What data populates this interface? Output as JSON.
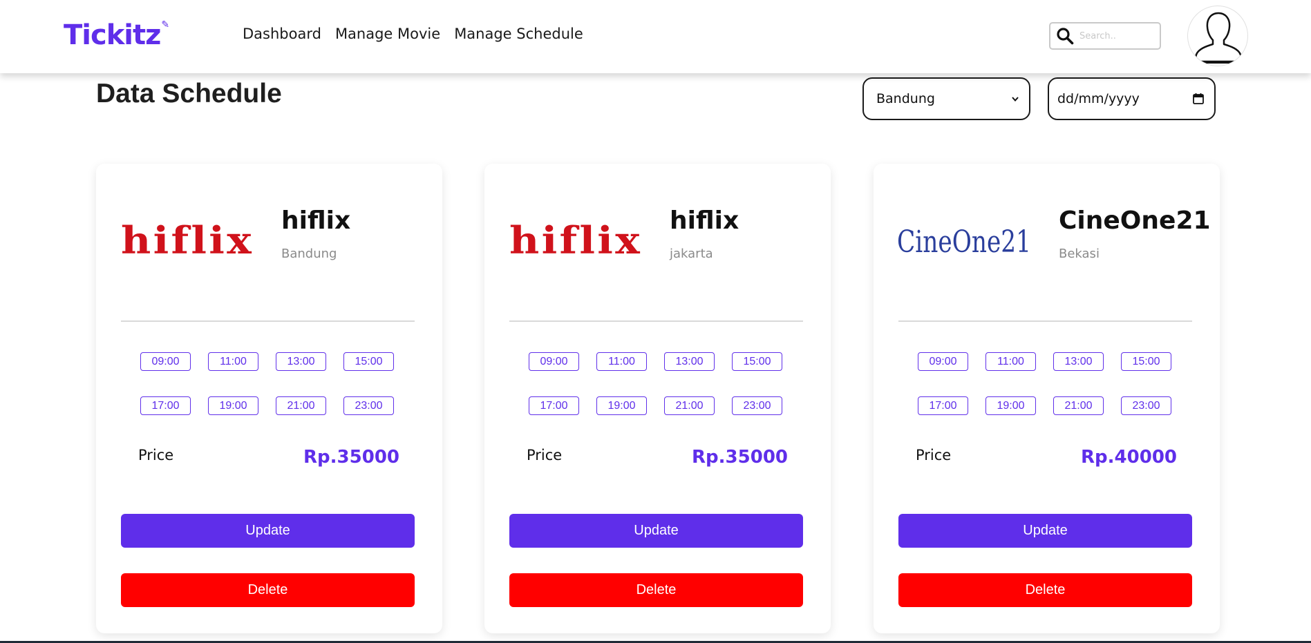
{
  "brand": {
    "name": "Tickitz",
    "accent": "#5F2EEA"
  },
  "nav": {
    "links": [
      {
        "label": "Dashboard"
      },
      {
        "label": "Manage Movie"
      },
      {
        "label": "Manage Schedule"
      }
    ],
    "search": {
      "placeholder": "Search..",
      "value": ""
    }
  },
  "page": {
    "title": "Data Schedule",
    "filters": {
      "location": {
        "selected": "Bandung"
      },
      "date": {
        "value": "dd/mm/yyyy"
      }
    }
  },
  "cards": [
    {
      "cinema": "hiflix",
      "city": "Bandung",
      "times": [
        "09:00",
        "11:00",
        "13:00",
        "15:00",
        "17:00",
        "19:00",
        "21:00",
        "23:00"
      ],
      "price_label": "Price",
      "price": "Rp.35000",
      "update_label": "Update",
      "delete_label": "Delete"
    },
    {
      "cinema": "hiflix",
      "city": "jakarta",
      "times": [
        "09:00",
        "11:00",
        "13:00",
        "15:00",
        "17:00",
        "19:00",
        "21:00",
        "23:00"
      ],
      "price_label": "Price",
      "price": "Rp.35000",
      "update_label": "Update",
      "delete_label": "Delete"
    },
    {
      "cinema": "CineOne21",
      "city": "Bekasi",
      "times": [
        "09:00",
        "11:00",
        "13:00",
        "15:00",
        "17:00",
        "19:00",
        "21:00",
        "23:00"
      ],
      "price_label": "Price",
      "price": "Rp.40000",
      "update_label": "Update",
      "delete_label": "Delete"
    }
  ],
  "colors": {
    "update": "#5F2EEA",
    "delete": "#FF0000",
    "hiflix_logo": "#D0121B",
    "cineone_logo": "#2A3E9C"
  }
}
